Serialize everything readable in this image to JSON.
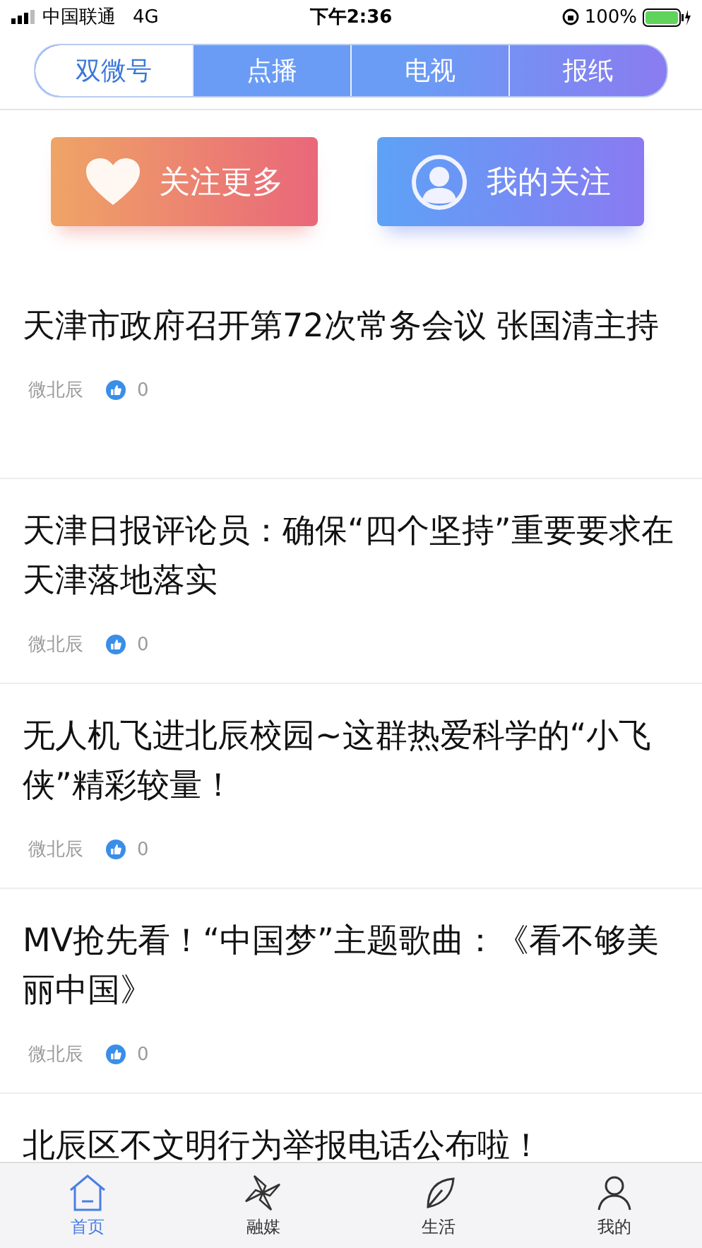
{
  "status_bar": {
    "carrier": "中国联通",
    "network": "4G",
    "time": "下午2:36",
    "battery": "100%"
  },
  "tabs": [
    {
      "label": "双微号",
      "selected": true
    },
    {
      "label": "点播",
      "selected": false
    },
    {
      "label": "电视",
      "selected": false
    },
    {
      "label": "报纸",
      "selected": false
    }
  ],
  "actions": [
    {
      "label": "关注更多",
      "kind": "heart"
    },
    {
      "label": "我的关注",
      "kind": "person"
    }
  ],
  "articles": [
    {
      "title": "天津市政府召开第72次常务会议 张国清主持",
      "source": "微北辰",
      "likes": "0"
    },
    {
      "title": "天津日报评论员：确保“四个坚持”重要要求在天津落地落实",
      "source": "微北辰",
      "likes": "0"
    },
    {
      "title": "无人机飞进北辰校园~这群热爱科学的“小飞侠”精彩较量！",
      "source": "微北辰",
      "likes": "0"
    },
    {
      "title": "MV抢先看！“中国梦”主题歌曲：《看不够美丽中国》",
      "source": "微北辰",
      "likes": "0"
    },
    {
      "title": "北辰区不文明行为举报电话公布啦！"
    }
  ],
  "tab_bar": [
    {
      "label": "首页",
      "kind": "home",
      "selected": true
    },
    {
      "label": "融媒",
      "kind": "pinwheel",
      "selected": false
    },
    {
      "label": "生活",
      "kind": "life",
      "selected": false
    },
    {
      "label": "我的",
      "kind": "person",
      "selected": false
    }
  ]
}
